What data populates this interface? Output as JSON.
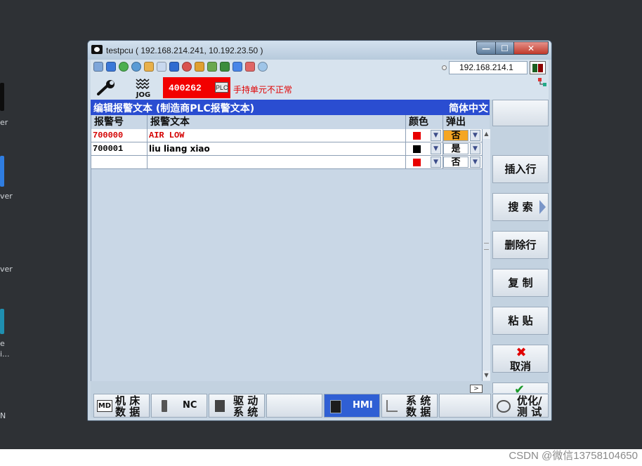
{
  "window": {
    "title": "testpcu ( 192.168.214.241, 10.192.23.50 )",
    "min_glyph": "—",
    "max_glyph": "☐",
    "close_glyph": "✕"
  },
  "toolbar": {
    "ip": "192.168.214.1",
    "icons": [
      "network-icon",
      "window-icon",
      "globe-icon",
      "refresh-icon",
      "settings-icon",
      "text-icon",
      "book-icon",
      "ball-icon",
      "flag-icon",
      "puzzle-icon",
      "tree-icon",
      "transfer-icon",
      "download-icon",
      "link-icon"
    ]
  },
  "status": {
    "mode": "JOG",
    "alarm_number": "400262",
    "alarm_tag": "PLC",
    "alarm_text": "手持单元不正常"
  },
  "header": {
    "title": "编辑报警文本 (制造商PLC报警文本)",
    "language": "简体中文"
  },
  "table": {
    "columns": [
      "报警号",
      "报警文本",
      "颜色",
      "弹出"
    ],
    "rows": [
      {
        "number": "700000",
        "text": "AIR LOW",
        "color": "#e80000",
        "popup": "否",
        "popup_bg": "#f5a623",
        "num_color": "#d40000"
      },
      {
        "number": "700001",
        "text": "liu liang xiao",
        "color": "#000000",
        "popup": "是",
        "popup_bg": "#ffffff",
        "num_color": "#000000"
      },
      {
        "number": "",
        "text": "",
        "color": "#e80000",
        "popup": "否",
        "popup_bg": "#ffffff",
        "num_color": "#000000"
      }
    ],
    "scroll_right": ">"
  },
  "softkeys": {
    "insert_row": "插入行",
    "search": "搜 索",
    "delete_row": "删除行",
    "copy": "复 制",
    "paste": "粘 贴",
    "cancel": "取消",
    "confirm": "确认"
  },
  "bottom": {
    "machine_data": [
      "机 床",
      "数 据"
    ],
    "machine_data_icon": "MD",
    "nc": "NC",
    "drive": [
      "驱 动",
      "系 统"
    ],
    "hmi": "HMI",
    "system_data": [
      "系 统",
      "数 据"
    ],
    "optimize": [
      "优化/",
      "测 试"
    ]
  },
  "desktop": {
    "labels": [
      "er",
      "ver",
      "ver",
      "e",
      "i...",
      "N"
    ]
  },
  "watermark": "CSDN @微信13758104650",
  "colors": {
    "header_blue": "#2a4dd1",
    "alarm_red": "#f20000",
    "active_key": "#2f5fd4"
  }
}
